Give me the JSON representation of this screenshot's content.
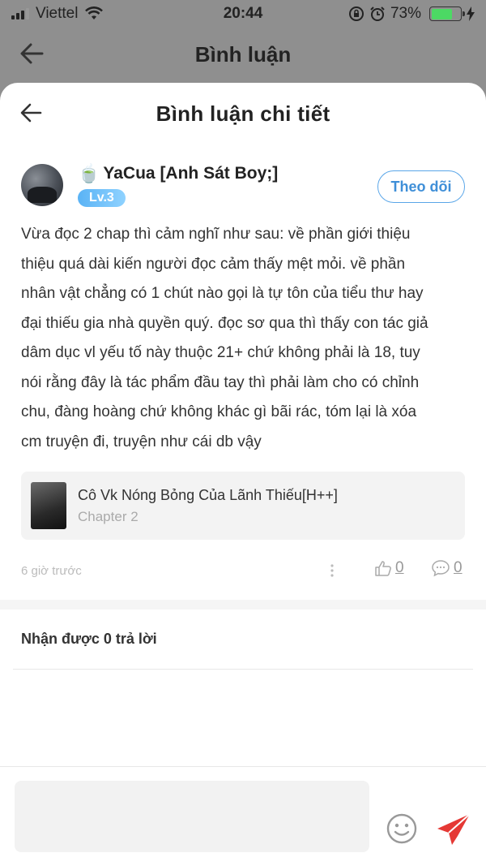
{
  "status_bar": {
    "carrier": "Viettel",
    "time": "20:44",
    "battery_percent": "73%",
    "battery_level": 0.73
  },
  "background_header": {
    "title": "Bình luận"
  },
  "sheet": {
    "title": "Bình luận chi tiết"
  },
  "comment": {
    "user_name": "YaCua [Anh Sát Boy;]",
    "level": "Lv.3",
    "follow_label": "Theo dõi",
    "lines": [
      "Vừa đọc 2 chap thì cảm nghĩ như sau: về phần giới thiệu",
      "thiệu quá dài kiến người đọc cảm thấy mệt mỏi. về phần",
      "nhân vật chẳng có 1 chút nào gọi là tự tôn của tiểu thư hay",
      "đại thiếu gia nhà quyền quý. đọc sơ qua thì thấy con tác giả",
      "dâm dục vl yếu tố này thuộc 21+ chứ không phải là 18, tuy",
      "nói rằng đây là tác phẩm đầu tay thì phải làm cho có chỉnh",
      "chu, đàng hoàng chứ không khác gì bãi rác, tóm lại là xóa",
      "cm truyện đi, truyện như cái db vậy"
    ],
    "story": {
      "title": "Cô Vk Nóng Bỏng Của Lãnh Thiếu[H++]",
      "chapter": "Chapter 2"
    },
    "time_ago": "6 giờ trước",
    "likes": "0",
    "replies": "0"
  },
  "replies_heading": "Nhận được 0 trả lời",
  "input": {
    "placeholder": ""
  },
  "colors": {
    "accent": "#3f8fd8",
    "send": "#e53935",
    "level_badge": "#5ab3f5"
  }
}
